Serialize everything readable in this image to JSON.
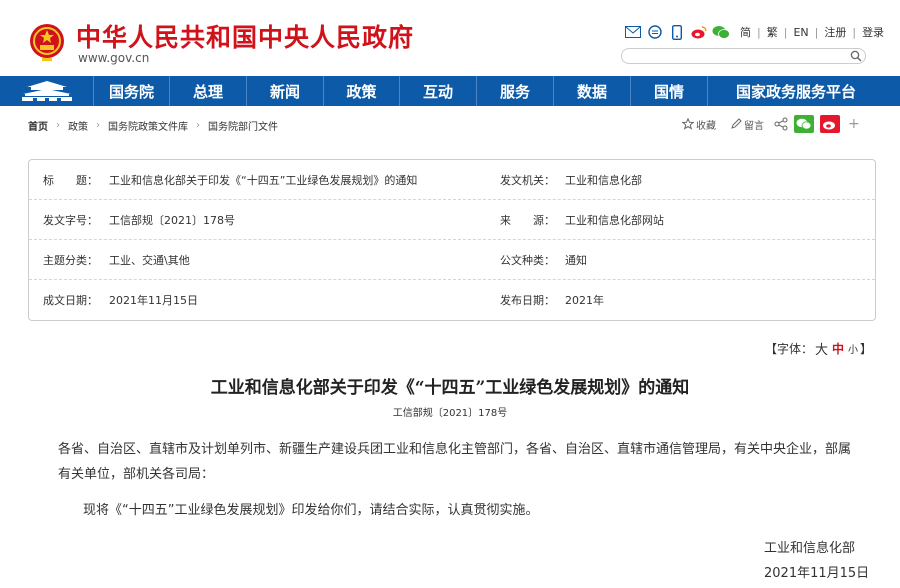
{
  "header": {
    "site_title": "中华人民共和国中央人民政府",
    "site_url": "www.gov.cn",
    "top_links": [
      "简",
      "繁",
      "EN",
      "注册",
      "登录"
    ],
    "top_icons": [
      "mail-icon",
      "message-icon",
      "mobile-icon",
      "weibo-icon",
      "wechat-icon"
    ],
    "search_placeholder": ""
  },
  "nav": {
    "items": [
      "国务院",
      "总理",
      "新闻",
      "政策",
      "互动",
      "服务",
      "数据",
      "国情",
      "国家政务服务平台"
    ]
  },
  "breadcrumb": [
    "首页",
    "政策",
    "国务院政策文件库",
    "国务院部门文件"
  ],
  "share": {
    "collect": "收藏",
    "comment": "留言"
  },
  "meta": {
    "title_label": "标　　题：",
    "title_value": "工业和信息化部关于印发《“十四五”工业绿色发展规划》的通知",
    "issuer_label": "发文机关：",
    "issuer_value": "工业和信息化部",
    "docno_label": "发文字号：",
    "docno_value": "工信部规〔2021〕178号",
    "source_label": "来　　源：",
    "source_value": "工业和信息化部网站",
    "topic_label": "主题分类：",
    "topic_value": "工业、交通\\其他",
    "type_label": "公文种类：",
    "type_value": "通知",
    "date_label": "成文日期：",
    "date_value": "2021年11月15日",
    "pub_label": "发布日期：",
    "pub_value": "2021年"
  },
  "font_size": {
    "prefix": "【字体：",
    "large": "大",
    "medium": "中",
    "small": "小",
    "suffix": "】"
  },
  "article": {
    "title": "工业和信息化部关于印发《“十四五”工业绿色发展规划》的通知",
    "docno": "工信部规〔2021〕178号",
    "para1": "各省、自治区、直辖市及计划单列市、新疆生产建设兵团工业和信息化主管部门，各省、自治区、直辖市通信管理局，有关中央企业，部属有关单位，部机关各司局：",
    "para2": "现将《“十四五”工业绿色发展规划》印发给你们，请结合实际，认真贯彻实施。",
    "sign_org": "工业和信息化部",
    "sign_date": "2021年11月15日"
  },
  "colors": {
    "brand_red": "#d0121b",
    "nav_blue": "#0c5aa8"
  }
}
